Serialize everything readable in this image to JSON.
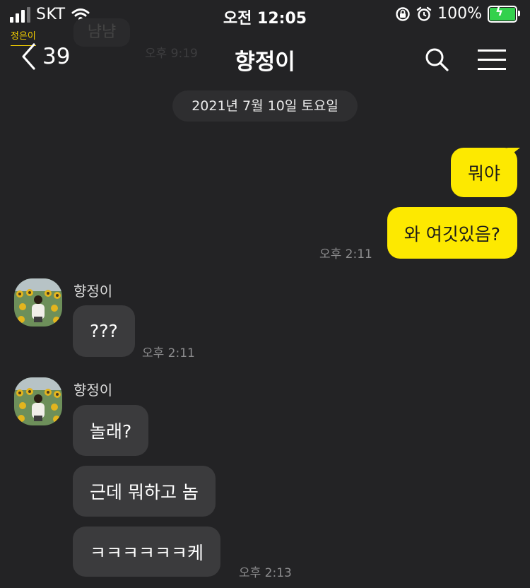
{
  "status_bar": {
    "carrier": "SKT",
    "time": "오전 12:05",
    "battery": "100%"
  },
  "pip_label": "정은이",
  "ghost": {
    "text": "냠냠",
    "time": "오후 9:19"
  },
  "nav": {
    "unread_count": "39",
    "title": "향정이"
  },
  "date_divider": "2021년 7월 10일 토요일",
  "outgoing": {
    "messages": [
      "뭐야",
      "와 여깃있음?"
    ],
    "time": "오후 2:11"
  },
  "incoming": [
    {
      "sender": "향정이",
      "messages": [
        "???"
      ],
      "time": "오후 2:11"
    },
    {
      "sender": "향정이",
      "messages": [
        "놀래?",
        "근데 뭐하고 놈",
        "ㅋㅋㅋㅋㅋㅋ케"
      ],
      "time": "오후 2:13"
    }
  ],
  "colors": {
    "background": "#232325",
    "my_bubble": "#fde900",
    "their_bubble": "#3b3b3d",
    "battery": "#33d14d"
  }
}
